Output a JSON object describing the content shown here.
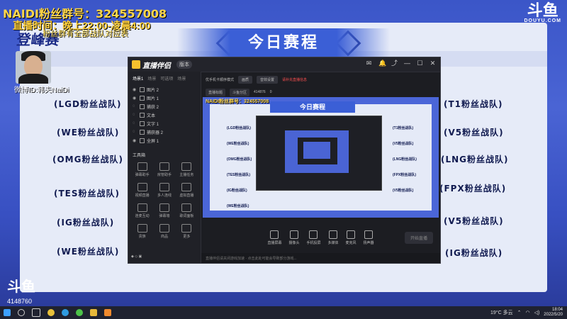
{
  "overlay": {
    "fan_group": "NAIDI粉丝群号：324557008",
    "schedule_line": "直播时间：晚上22:00-凌晨4:00",
    "tip_line": "粉丝群有全部战队对应表",
    "weibo": "微博ID:韩夫NaiDi",
    "room_id": "4148760",
    "brand_top": "斗鱼",
    "brand_top_sub": "DOUYU.COM",
    "brand_bottom": "斗鱼",
    "logo_text": "登峰赛"
  },
  "schedule": {
    "title": "今日赛程",
    "left_teams": [
      "(LGD粉丝战队)",
      "(WE粉丝战队)",
      "(OMG粉丝战队)",
      "(TES粉丝战队)",
      "(IG粉丝战队)",
      "(WE粉丝战队)"
    ],
    "right_teams": [
      "(T1粉丝战队)",
      "(V5粉丝战队)",
      "(LNG粉丝战队)",
      "(FPX粉丝战队)",
      "(V5粉丝战队)",
      "(IG粉丝战队)"
    ]
  },
  "app": {
    "title": "直播伴侣",
    "version_badge": "版本",
    "side_tabs": [
      "场景1",
      "场景",
      "可选项",
      "场景"
    ],
    "scenes": [
      "图片 2",
      "图片 1",
      "捕获 2",
      "文本",
      "文字 1",
      "捕获器 2",
      "全屏 1"
    ],
    "tools_title": "工具箱",
    "tools": [
      "弹幕助手",
      "房管助手",
      "主播任务",
      "视频直播",
      "多人连线",
      "虚拟直播",
      "连麦互动",
      "弹幕墙",
      "歌词面板",
      "贵族",
      "商品",
      "更多"
    ],
    "toolbar": {
      "mode": "优手机卡顺序模式",
      "btn1": "画质",
      "btn2": "音效设置",
      "warn": "请补充直播信息",
      "room_label": "直播标题",
      "category": "斗鱼分区",
      "views": "414876",
      "num": "0"
    },
    "controls": [
      "直播屏幕",
      "摄像头",
      "手机投屏",
      "多媒体",
      "麦克风",
      "扬声器"
    ],
    "start_label": "开始直播",
    "status_text": "直播伴侣请关闭游戏加速 · 点击此处可能会导致部分游戏..."
  },
  "taskbar": {
    "weather": "19°C 多云",
    "time": "18:04",
    "date": "2022/5/20",
    "icons": [
      "windows-start",
      "search",
      "task-view",
      "chrome",
      "edge",
      "wechat",
      "folder",
      "app"
    ]
  }
}
